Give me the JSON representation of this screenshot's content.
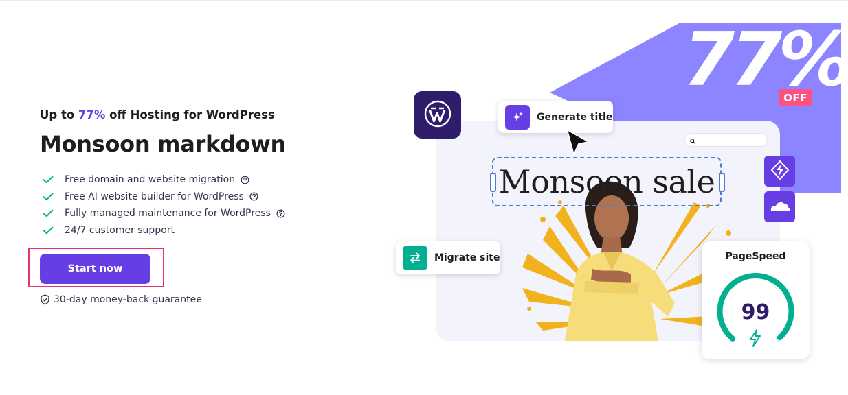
{
  "promo": {
    "subtitle_prefix": "Up to ",
    "subtitle_highlight": "77%",
    "subtitle_suffix": " off Hosting for WordPress",
    "title": "Monsoon markdown",
    "features": [
      {
        "label": "Free domain and website migration",
        "has_help": true
      },
      {
        "label": "Free AI website builder for WordPress",
        "has_help": true
      },
      {
        "label": "Fully managed maintenance for WordPress",
        "has_help": true
      },
      {
        "label": "24/7 customer support",
        "has_help": false
      }
    ],
    "cta_label": "Start now",
    "guarantee": "30-day money-back guarantee"
  },
  "hero": {
    "discount_value": "77%",
    "discount_suffix": "OFF",
    "headline": "Monsoon sale",
    "generate_chip": "Generate title",
    "migrate_chip": "Migrate site",
    "pagespeed_label": "PageSpeed",
    "pagespeed_score": "99",
    "pagespeed_fraction": 0.99
  },
  "icons": {
    "feature_check": "check-icon",
    "feature_help": "question-circle-icon",
    "guarantee": "shield-check-icon",
    "wordpress": "wordpress-logo-icon",
    "generate": "sparkles-icon",
    "migrate": "swap-arrows-icon",
    "litespeed": "litespeed-icon",
    "cloudflare": "cloudflare-icon",
    "pagespeed": "lightning-icon",
    "search": "search-icon"
  },
  "colors": {
    "brand_purple": "#673de6",
    "hero_purple": "#8c85ff",
    "check_green": "#00b090",
    "highlight_frame": "#e3317c",
    "off_badge": "#fc5185",
    "gauge_green": "#00b090"
  }
}
